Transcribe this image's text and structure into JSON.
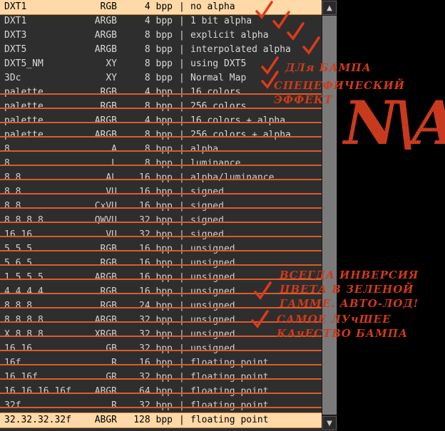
{
  "list": {
    "rows": [
      {
        "name": "DXT1",
        "format": "RGB",
        "bpp": "4 bpp",
        "desc": "no alpha",
        "selected": true
      },
      {
        "name": "DXT1",
        "format": "ARGB",
        "bpp": "4 bpp",
        "desc": "1 bit alpha"
      },
      {
        "name": "DXT3",
        "format": "ARGB",
        "bpp": "8 bpp",
        "desc": "explicit alpha"
      },
      {
        "name": "DXT5",
        "format": "ARGB",
        "bpp": "8 bpp",
        "desc": "interpolated alpha"
      },
      {
        "name": "DXT5_NM",
        "format": "XY",
        "bpp": "8 bpp",
        "desc": "using DXT5"
      },
      {
        "name": "3Dc",
        "format": "XY",
        "bpp": "8 bpp",
        "desc": "Normal Map"
      },
      {
        "name": "palette",
        "format": "RGB",
        "bpp": "4 bpp",
        "desc": "16 colors"
      },
      {
        "name": "palette",
        "format": "RGB",
        "bpp": "8 bpp",
        "desc": "256 colors"
      },
      {
        "name": "palette",
        "format": "ARGB",
        "bpp": "4 bpp",
        "desc": "16 colors + alpha"
      },
      {
        "name": "palette",
        "format": "ARGB",
        "bpp": "8 bpp",
        "desc": "256 colors + alpha"
      },
      {
        "name": "8",
        "format": "A",
        "bpp": "8 bpp",
        "desc": "alpha"
      },
      {
        "name": "8",
        "format": "L",
        "bpp": "8 bpp",
        "desc": "luminance"
      },
      {
        "name": "8.8",
        "format": "AL",
        "bpp": "16 bpp",
        "desc": "alpha/luminance"
      },
      {
        "name": "8.8",
        "format": "VU",
        "bpp": "16 bpp",
        "desc": "signed"
      },
      {
        "name": "8.8",
        "format": "CxVU",
        "bpp": "16 bpp",
        "desc": "signed"
      },
      {
        "name": "8.8.8.8",
        "format": "QWVU",
        "bpp": "32 bpp",
        "desc": "signed"
      },
      {
        "name": "16.16",
        "format": "VU",
        "bpp": "32 bpp",
        "desc": "signed"
      },
      {
        "name": "5.5.5",
        "format": "RGB",
        "bpp": "16 bpp",
        "desc": "unsigned"
      },
      {
        "name": "5.6.5",
        "format": "RGB",
        "bpp": "16 bpp",
        "desc": "unsigned"
      },
      {
        "name": "1.5.5.5",
        "format": "ARGB",
        "bpp": "16 bpp",
        "desc": "unsigned"
      },
      {
        "name": "4.4.4.4",
        "format": "RGB",
        "bpp": "16 bpp",
        "desc": "unsigned"
      },
      {
        "name": "8.8.8",
        "format": "RGB",
        "bpp": "24 bpp",
        "desc": "unsigned"
      },
      {
        "name": "8.8.8.8",
        "format": "ARGB",
        "bpp": "32 bpp",
        "desc": "unsigned"
      },
      {
        "name": "X.8.8.8",
        "format": "XRGB",
        "bpp": "32 bpp",
        "desc": "unsigned"
      },
      {
        "name": "16.16",
        "format": "GB",
        "bpp": "32 bpp",
        "desc": "unsigned"
      },
      {
        "name": "16f",
        "format": "R",
        "bpp": "16 bpp",
        "desc": "floating point"
      },
      {
        "name": "16.16f",
        "format": "GR",
        "bpp": "32 bpp",
        "desc": "floating point"
      },
      {
        "name": "16.16.16.16f",
        "format": "ABGR",
        "bpp": "64 bpp",
        "desc": "floating point"
      },
      {
        "name": "32f",
        "format": "R",
        "bpp": "32 bpp",
        "desc": "floating point"
      },
      {
        "name": "32.32.32.32f",
        "format": "ABGR",
        "bpp": "128 bpp",
        "desc": "floating point",
        "selected": true
      }
    ],
    "separator": "|"
  },
  "scrollbar": {
    "up_arrow": "▲",
    "down_arrow": "▼"
  },
  "annotations": {
    "bump_note": "ДЛя БАМПА",
    "specific_note": "СПЕЦЕФИЧЕСКИЙ\nЭФФЕКТ",
    "na_label": "N\\A",
    "green_note": "ВСЕГДА ИНВЕРСИЯ\nЦВЕТА В ЗЕЛЕНОЙ\nГАММЕ. АВТО-ЛОД!",
    "best_note": "САМОЕ ЛУчШЕЕ\nКАчЕСТВО БАМПА"
  },
  "colors": {
    "annotation": "#d03a1a",
    "strike": "#e05a2a",
    "selected_bg": "#ffd9a8",
    "list_bg": "#2e2e2e"
  }
}
